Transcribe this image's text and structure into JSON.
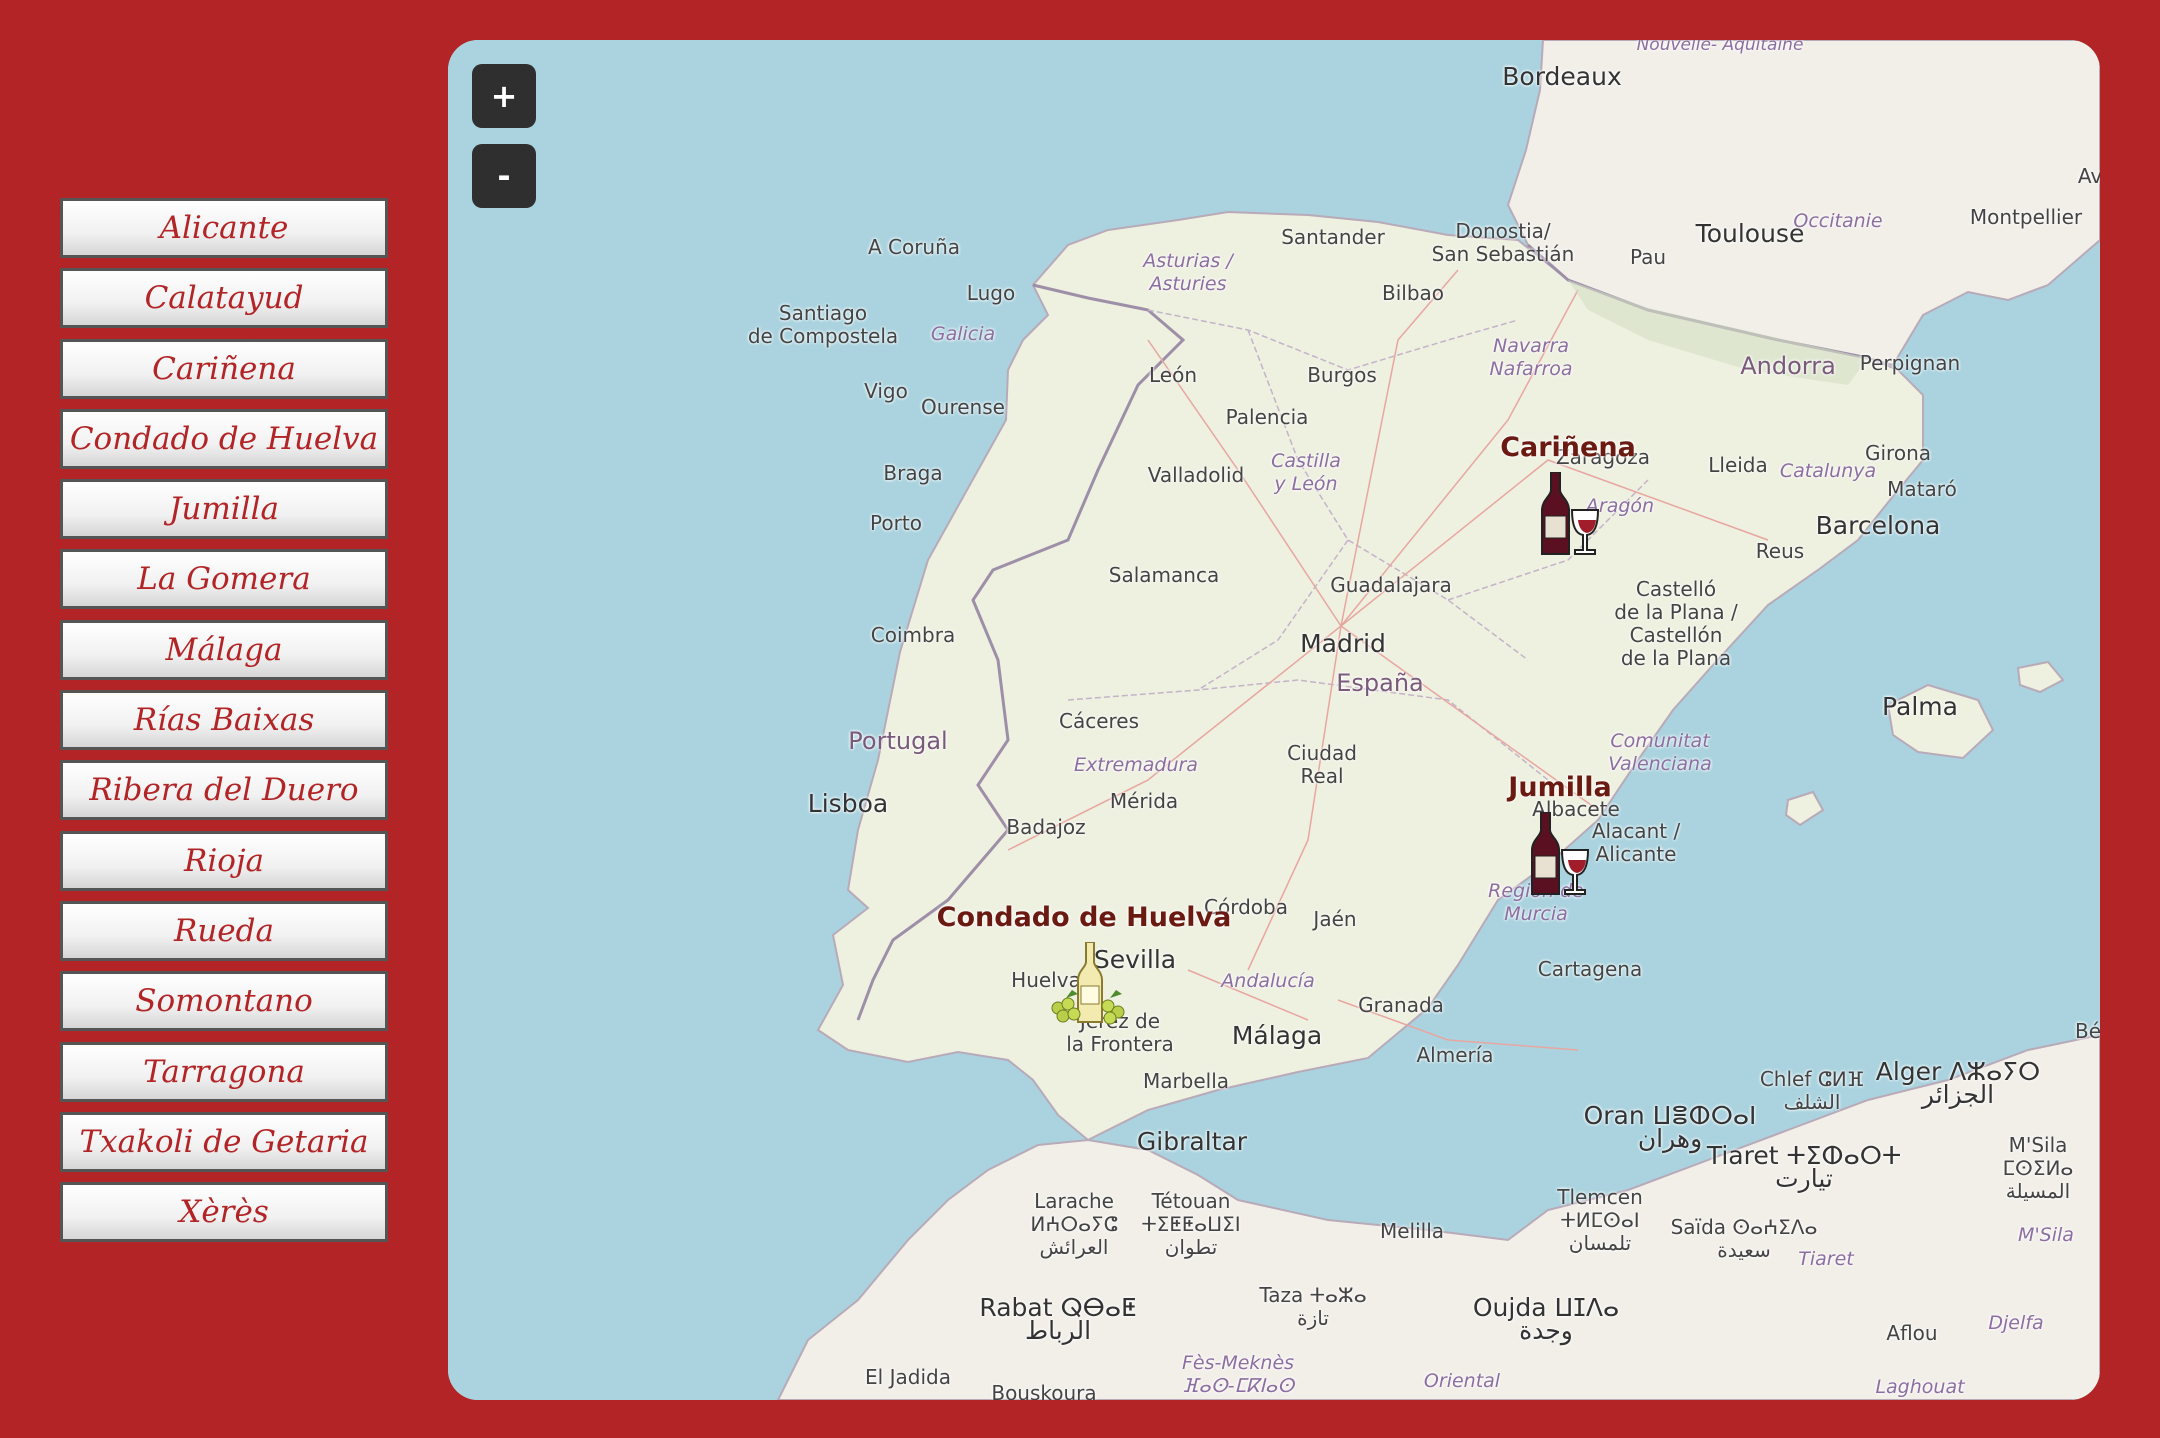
{
  "sidebar": {
    "items": [
      {
        "label": "Alicante"
      },
      {
        "label": "Calatayud"
      },
      {
        "label": "Cariñena"
      },
      {
        "label": "Condado de Huelva"
      },
      {
        "label": "Jumilla"
      },
      {
        "label": "La Gomera"
      },
      {
        "label": "Málaga"
      },
      {
        "label": "Rías Baixas"
      },
      {
        "label": "Ribera del Duero"
      },
      {
        "label": "Rioja"
      },
      {
        "label": "Rueda"
      },
      {
        "label": "Somontano"
      },
      {
        "label": "Tarragona"
      },
      {
        "label": "Txakoli de Getaria"
      },
      {
        "label": "Xèrès"
      }
    ]
  },
  "map": {
    "zoom_in_label": "+",
    "zoom_out_label": "-",
    "markers": [
      {
        "name": "Cariñena",
        "icon": "red-wine-bottle-glass-icon"
      },
      {
        "name": "Jumilla",
        "icon": "red-wine-bottle-glass-icon"
      },
      {
        "name": "Condado de Huelva",
        "icon": "white-wine-bottle-grapes-icon"
      }
    ],
    "place_labels": {
      "bordeaux": "Bordeaux",
      "nouvelle_aquitaine": "Nouvelle-\nAquitaine",
      "toulouse": "Toulouse",
      "occitanie": "Occitanie",
      "montpellier": "Montpellier",
      "av": "Av",
      "a_coruna": "A Coruña",
      "asturias": "Asturias /\nAsturies",
      "santander": "Santander",
      "donostia": "Donostia/\nSan Sebastián",
      "pau": "Pau",
      "lugo": "Lugo",
      "bilbao": "Bilbao",
      "santiago": "Santiago\nde Compostela",
      "galicia": "Galicia",
      "navarra": "Navarra\nNafarroa",
      "andorra": "Andorra",
      "perpignan": "Perpignan",
      "leon": "León",
      "burgos": "Burgos",
      "vigo": "Vigo",
      "ourense": "Ourense",
      "palencia": "Palencia",
      "zaragoza": "Zaragoza",
      "lleida": "Lleida",
      "girona": "Girona",
      "braga": "Braga",
      "castilla": "Castilla\ny León",
      "valladolid": "Valladolid",
      "aragon": "Aragón",
      "catalunya": "Catalunya",
      "mataro": "Mataró",
      "porto": "Porto",
      "barcelona": "Barcelona",
      "reus": "Reus",
      "salamanca": "Salamanca",
      "guadalajara": "Guadalajara",
      "castello": "Castelló\nde la Plana /\nCastellón\nde la Plana",
      "coimbra": "Coimbra",
      "madrid": "Madrid",
      "espana": "España",
      "palma": "Palma",
      "caceres": "Cáceres",
      "portugal": "Portugal",
      "extremadura": "Extremadura",
      "ciudad_real": "Ciudad\nReal",
      "comunitat": "Comunitat\nValenciana",
      "merida": "Mérida",
      "albacete": "Albacete",
      "lisboa": "Lisboa",
      "badajoz": "Badajoz",
      "alacant": "Alacant /\nAlicante",
      "cordoba": "Córdoba",
      "jaen": "Jaén",
      "region_murcia": "Región de\nMurcia",
      "sevilla": "Sevilla",
      "huelva": "Huelva",
      "andalucia": "Andalucía",
      "cartagena": "Cartagena",
      "jerez": "Jerez de\nla Frontera",
      "granada": "Granada",
      "malaga": "Málaga",
      "almeria": "Almería",
      "marbella": "Marbella",
      "chlef": "Chlef ⵛⵍⴼ\nالشلف",
      "alger": "Alger ⴷⵣⴰⵢⵔ\nالجزائر",
      "be": "Bé",
      "oran": "Oran ⵡⴻⵀⵔⴰⵏ\nوهران",
      "gibraltar": "Gibraltar",
      "tiaret": "Tiaret ⵜⵉⵀⴰⵔⵜ\nتيارت",
      "msila": "M'Sila\nⵎⵙⵉⵍⴰ\nالمسيلة",
      "larache": "Larache\nⵍⵄⵔⴰⵢⵛ\nالعرائش",
      "tetouan": "Tétouan\nⵜⵉⵟⵟⴰⵡⵉⵏ\nتطوان",
      "tlemcen": "Tlemcen\nⵜⵍⵎⵙⴰⵏ\nتلمسان",
      "melilla": "Melilla",
      "saida": "Saïda ⵙⴰⵄⵉⴷⴰ\nسعيدة",
      "tiaret_region": "Tiaret",
      "msila_region": "M'Sila",
      "taza": "Taza ⵜⴰⵣⴰ\nتازة",
      "rabat": "Rabat ⵕⴱⴰⵟ\nالرباط",
      "oujda": "Oujda ⵡⵊⴷⴰ\nوجدة",
      "aflou": "Aflou",
      "djelfa": "Djelfa",
      "el_jadida": "El Jadida",
      "fes": "Fès-Meknès\nⴼⴰⵙ-ⵎⴽⵏⴰⵙ",
      "bouskoura": "Bouskoura",
      "oriental": "Oriental",
      "laghouat": "Laghouat"
    }
  }
}
